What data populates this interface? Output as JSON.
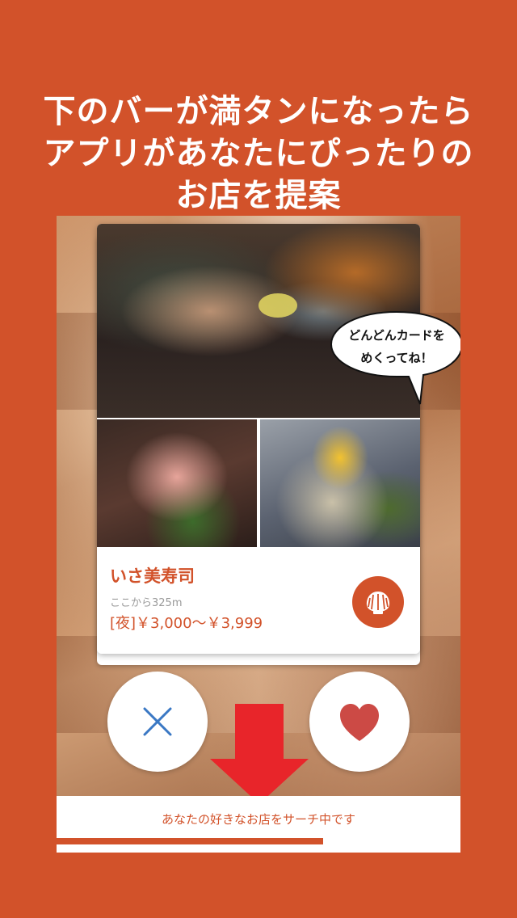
{
  "headline": {
    "line1": "下のバーが満タンになったら",
    "line2": "アプリがあなたにぴったりの",
    "line3": "お店を提案"
  },
  "card": {
    "shop_name": "いさ美寿司",
    "distance": "ここから325m",
    "price": "[夜]￥3,000〜￥3,999",
    "genre_icon": "shell-icon"
  },
  "speech_bubble": {
    "line1": "どんどんカードを",
    "line2": "めくってね！"
  },
  "actions": {
    "dislike_icon": "close-icon",
    "like_icon": "heart-icon",
    "dislike_color": "#3a78c4",
    "like_color": "#cc4a45"
  },
  "status": {
    "text": "あなたの好きなお店をサーチ中です",
    "progress": 0.66
  },
  "colors": {
    "brand": "#d2522a",
    "arrow": "#e8252a"
  }
}
